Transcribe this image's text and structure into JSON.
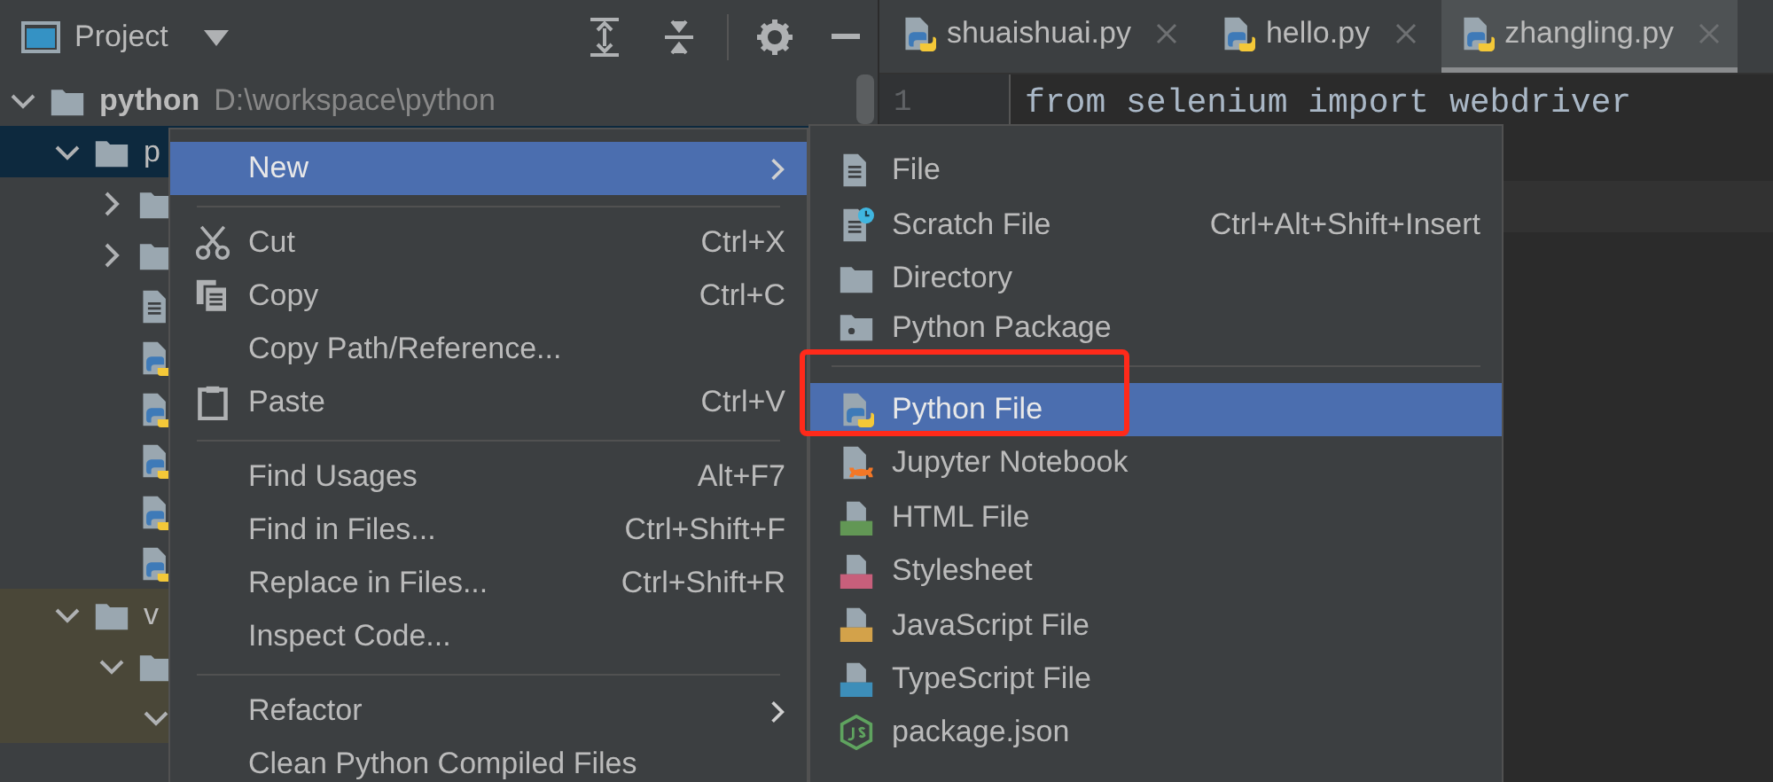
{
  "project_panel": {
    "title": "Project",
    "tree": [
      {
        "kind": "folder",
        "label": "python",
        "path": "D:\\workspace\\python",
        "expanded": true,
        "selected": false,
        "children": [
          {
            "kind": "folder",
            "label": "p",
            "expanded": true,
            "selected": true,
            "children": [
              {
                "kind": "folder",
                "expanded": false,
                "selected": false
              },
              {
                "kind": "folder",
                "expanded": false,
                "selected": false
              },
              {
                "kind": "text-file",
                "selected": false
              },
              {
                "kind": "python-file",
                "selected": false
              },
              {
                "kind": "python-file",
                "selected": false
              },
              {
                "kind": "python-file",
                "selected": false
              },
              {
                "kind": "python-file",
                "selected": false
              },
              {
                "kind": "python-file",
                "selected": false
              }
            ]
          },
          {
            "kind": "folder",
            "label": "v",
            "expanded": true,
            "selected": false,
            "excluded": true,
            "children": [
              {
                "kind": "folder",
                "expanded": true,
                "selected": false,
                "excluded": true,
                "children": [
                  {
                    "expanded": true,
                    "selected": false,
                    "excluded": true
                  }
                ]
              }
            ]
          }
        ]
      }
    ]
  },
  "editor": {
    "tabs": [
      {
        "label": "shuaishuai.py",
        "selected": false
      },
      {
        "label": "hello.py",
        "selected": false
      },
      {
        "label": "zhangling.py",
        "selected": true
      }
    ],
    "lines": [
      {
        "number": "1",
        "code": "from selenium import webdriver"
      }
    ]
  },
  "context_menu": {
    "items": [
      {
        "kind": "item",
        "label": "New",
        "submenu": true,
        "selected": true
      },
      {
        "kind": "separator"
      },
      {
        "kind": "cut",
        "label": "Cut",
        "shortcut": "Ctrl+X",
        "selected": false
      },
      {
        "kind": "copy",
        "label": "Copy",
        "shortcut": "Ctrl+C",
        "selected": false
      },
      {
        "kind": "item",
        "label": "Copy Path/Reference...",
        "selected": false
      },
      {
        "kind": "paste",
        "label": "Paste",
        "shortcut": "Ctrl+V",
        "selected": false
      },
      {
        "kind": "separator"
      },
      {
        "kind": "item",
        "label": "Find Usages",
        "shortcut": "Alt+F7",
        "selected": false
      },
      {
        "kind": "item",
        "label": "Find in Files...",
        "shortcut": "Ctrl+Shift+F",
        "selected": false
      },
      {
        "kind": "item",
        "label": "Replace in Files...",
        "shortcut": "Ctrl+Shift+R",
        "selected": false
      },
      {
        "kind": "item",
        "label": "Inspect Code...",
        "selected": false
      },
      {
        "kind": "separator"
      },
      {
        "kind": "item",
        "label": "Refactor",
        "submenu": true,
        "selected": false
      },
      {
        "kind": "item",
        "label": "Clean Python Compiled Files",
        "selected": false
      }
    ]
  },
  "new_submenu": {
    "items": [
      {
        "kind": "file",
        "label": "File",
        "selected": false
      },
      {
        "kind": "scratch",
        "label": "Scratch File",
        "shortcut": "Ctrl+Alt+Shift+Insert",
        "selected": false
      },
      {
        "kind": "folder",
        "label": "Directory",
        "selected": false
      },
      {
        "kind": "package",
        "label": "Python Package",
        "selected": false
      },
      {
        "kind": "separator"
      },
      {
        "kind": "python",
        "label": "Python File",
        "selected": true,
        "highlighted": true
      },
      {
        "kind": "jupyter",
        "label": "Jupyter Notebook",
        "selected": false
      },
      {
        "kind": "html",
        "label": "HTML File",
        "selected": false
      },
      {
        "kind": "css",
        "label": "Stylesheet",
        "selected": false
      },
      {
        "kind": "js",
        "label": "JavaScript File",
        "selected": false
      },
      {
        "kind": "ts",
        "label": "TypeScript File",
        "selected": false
      },
      {
        "kind": "node",
        "label": "package.json",
        "selected": false
      }
    ]
  }
}
